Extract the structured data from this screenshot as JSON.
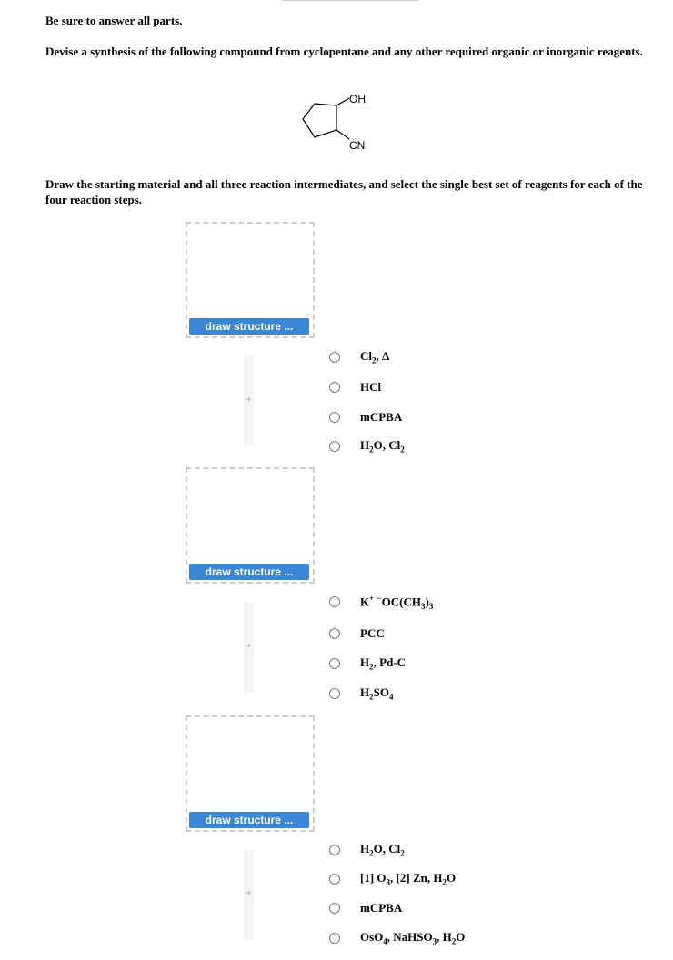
{
  "instructions": {
    "line1": "Be sure to answer all parts.",
    "line2": "Devise a synthesis of the following compound from cyclopentane and any other required organic or inorganic reagents.",
    "line3": "Draw the starting material and all three reaction intermediates, and select the single best set of reagents for each of the four reaction steps."
  },
  "molecule": {
    "label_oh": "OH",
    "label_cn": "CN"
  },
  "draw_button_label": "draw structure ...",
  "steps": [
    {
      "options": [
        [
          [
            "Cl"
          ],
          [
            "sub",
            "2"
          ],
          [
            ", Δ"
          ]
        ],
        [
          [
            "HCl"
          ]
        ],
        [
          [
            "mCPBA"
          ]
        ],
        [
          [
            "H"
          ],
          [
            "sub",
            "2"
          ],
          [
            "O, Cl"
          ],
          [
            "sub",
            "2"
          ]
        ]
      ]
    },
    {
      "options": [
        [
          [
            "K"
          ],
          [
            "sup",
            "+"
          ],
          [
            " "
          ],
          [
            "sup",
            "−"
          ],
          [
            "OC(CH"
          ],
          [
            "sub",
            "3"
          ],
          [
            ")"
          ],
          [
            "sub",
            "3"
          ]
        ],
        [
          [
            "PCC"
          ]
        ],
        [
          [
            "H"
          ],
          [
            "sub",
            "2"
          ],
          [
            ", Pd-C"
          ]
        ],
        [
          [
            "H"
          ],
          [
            "sub",
            "2"
          ],
          [
            "SO"
          ],
          [
            "sub",
            "4"
          ]
        ]
      ]
    },
    {
      "options": [
        [
          [
            "H"
          ],
          [
            "sub",
            "2"
          ],
          [
            "O, Cl"
          ],
          [
            "sub",
            "2"
          ]
        ],
        [
          [
            "[1] O"
          ],
          [
            "sub",
            "3"
          ],
          [
            ", [2] Zn, H"
          ],
          [
            "sub",
            "2"
          ],
          [
            "O"
          ]
        ],
        [
          [
            "mCPBA"
          ]
        ],
        [
          [
            "OsO"
          ],
          [
            "sub",
            "4"
          ],
          [
            ", NaHSO"
          ],
          [
            "sub",
            "3"
          ],
          [
            ", H"
          ],
          [
            "sub",
            "2"
          ],
          [
            "O"
          ]
        ]
      ]
    }
  ],
  "colors": {
    "button": "#3a87d6",
    "dashed_border": "#cccccc"
  }
}
